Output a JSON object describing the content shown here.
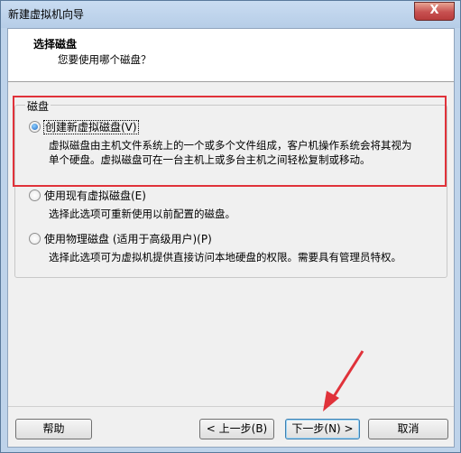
{
  "window": {
    "title": "新建虚拟机向导",
    "close_glyph": "X"
  },
  "header": {
    "title": "选择磁盘",
    "subtitle": "您要使用哪个磁盘？"
  },
  "group": {
    "label": "磁盘"
  },
  "options": [
    {
      "label": "创建新虚拟磁盘(V)",
      "selected": true,
      "description_lines": [
        "虚拟磁盘由主机文件系统上的一个或多个文件组成，客户机操作系统会将其视为",
        "单个硬盘。虚拟磁盘可在一台主机上或多台主机之间轻松复制或移动。"
      ]
    },
    {
      "label": "使用现有虚拟磁盘(E)",
      "selected": false,
      "description_lines": [
        "选择此选项可重新使用以前配置的磁盘。"
      ]
    },
    {
      "label": "使用物理磁盘 (适用于高级用户)(P)",
      "selected": false,
      "description_lines": [
        "选择此选项可为虚拟机提供直接访问本地硬盘的权限。需要具有管理员特权。"
      ]
    }
  ],
  "buttons": {
    "help": "帮助",
    "back": "< 上一步(B)",
    "next": "下一步(N) >",
    "cancel": "取消"
  },
  "annotation": {
    "highlight_color": "#e0323a",
    "arrow_color": "#e0323a"
  }
}
